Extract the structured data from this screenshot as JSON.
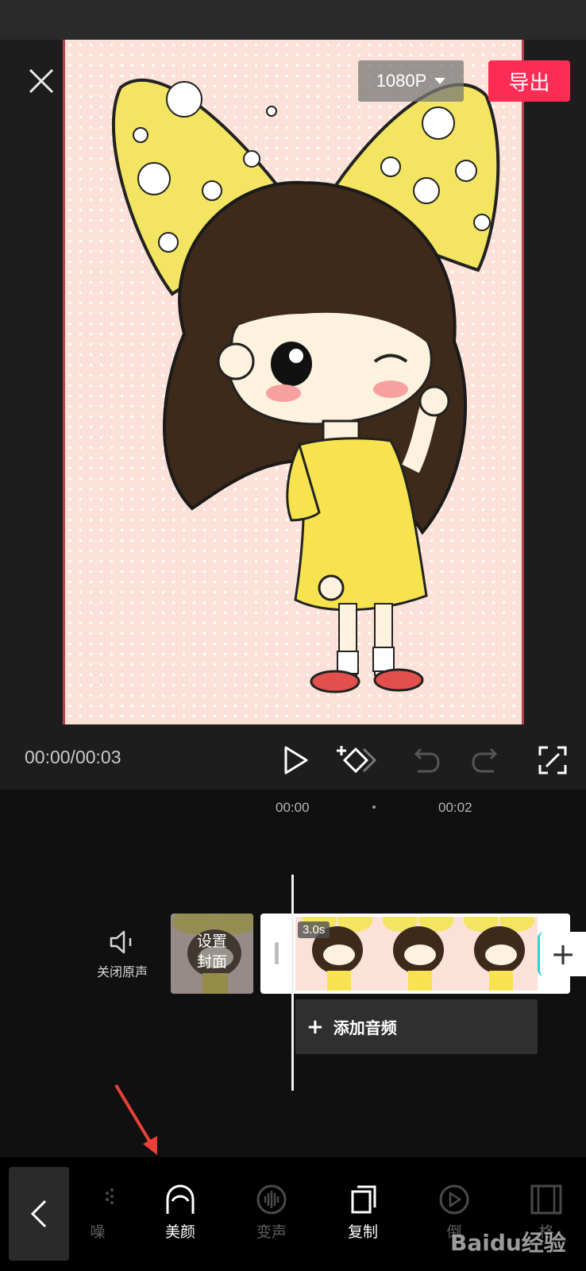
{
  "header": {
    "resolution": "1080P",
    "export_label": "导出"
  },
  "player": {
    "time": "00:00/00:03"
  },
  "timeline": {
    "ticks": [
      "00:00",
      "00:02"
    ],
    "mute_label": "关闭原声",
    "cover_label_line1": "设置",
    "cover_label_line2": "封面",
    "clip_duration": "3.0s",
    "add_audio_label": "添加音频"
  },
  "toolbar": {
    "items": [
      {
        "label": "噪",
        "icon": "denoise-icon"
      },
      {
        "label": "美颜",
        "icon": "beauty-icon"
      },
      {
        "label": "变声",
        "icon": "voice-change-icon"
      },
      {
        "label": "复制",
        "icon": "copy-icon"
      },
      {
        "label": "倒",
        "icon": "reverse-icon"
      },
      {
        "label": "格",
        "icon": "frame-icon"
      }
    ]
  },
  "watermark": "Baidu经验",
  "colors": {
    "accent": "#fd2c55",
    "clip_handle_accent": "#2fd3d9",
    "background": "#141414"
  }
}
